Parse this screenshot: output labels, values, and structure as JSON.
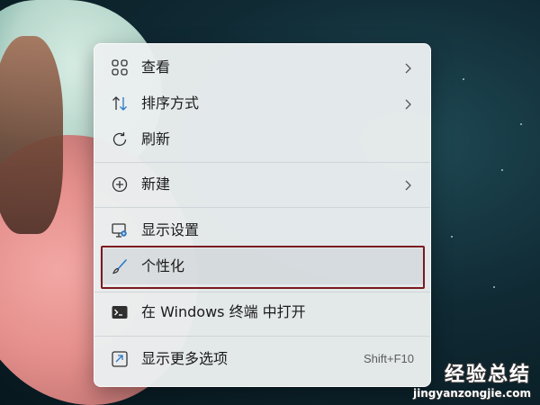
{
  "menu": {
    "items": [
      {
        "label": "查看",
        "icon": "grid-icon",
        "has_submenu": true
      },
      {
        "label": "排序方式",
        "icon": "sort-arrows-icon",
        "has_submenu": true
      },
      {
        "label": "刷新",
        "icon": "refresh-icon",
        "has_submenu": false
      },
      {
        "label": "新建",
        "icon": "add-circle-icon",
        "has_submenu": true
      },
      {
        "label": "显示设置",
        "icon": "display-settings-icon",
        "has_submenu": false
      },
      {
        "label": "个性化",
        "icon": "brush-icon",
        "has_submenu": false,
        "highlighted": true
      },
      {
        "label": "在 Windows 终端 中打开",
        "icon": "terminal-icon",
        "has_submenu": false
      },
      {
        "label": "显示更多选项",
        "icon": "more-options-icon",
        "has_submenu": false,
        "shortcut": "Shift+F10"
      }
    ]
  },
  "watermark": {
    "text": "经验总结",
    "url": "jingyanzongjie.com"
  },
  "colors": {
    "highlight_border": "#7a1a1f",
    "menu_background": "#eaeef0",
    "icon_accent": "#2b78c7"
  }
}
